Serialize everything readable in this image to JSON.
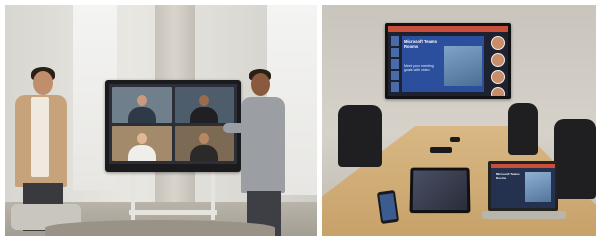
{
  "left_photo": {
    "subject": "meeting-room-with-video-hub",
    "screen_tile_colors": [
      "#6f7f8c",
      "#4d5d6b",
      "#a38a6b",
      "#7d6a55"
    ]
  },
  "right_photo": {
    "subject": "conference-room-with-wall-display",
    "tv_slide_title": "Microsoft Teams Rooms",
    "tv_slide_body": "Meet your meeting goals with video",
    "laptop_slide_title": "Microsoft Teams Rooms"
  },
  "colors": {
    "accent_red": "#c94f3b",
    "slide_blue": "#2b4f9c",
    "table_wood": "#d2ad76"
  }
}
